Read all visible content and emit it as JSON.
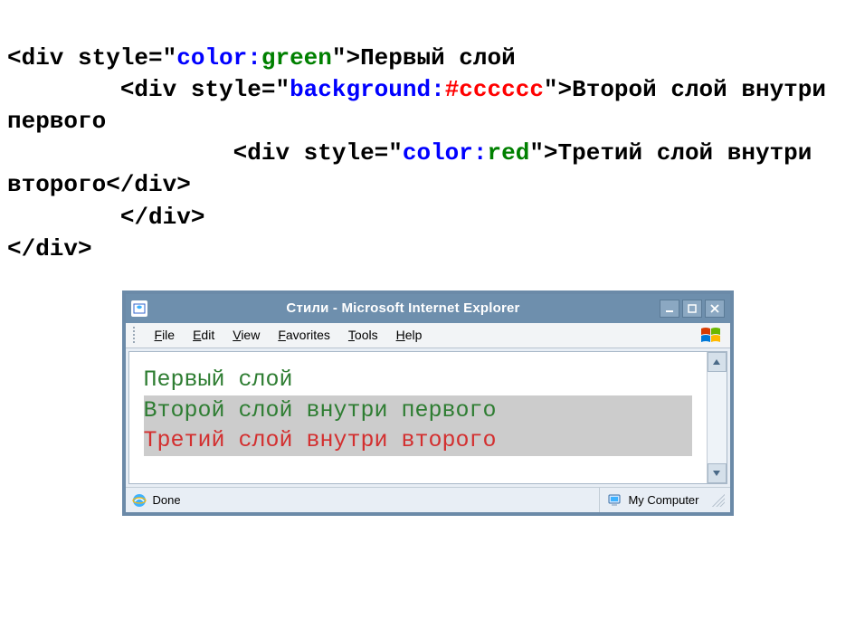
{
  "code": {
    "l1_open": "<div style=\"",
    "l1_prop": "color:",
    "l1_val": "green",
    "l1_close_and_text": "\">Первый слой",
    "l2_indent": "        ",
    "l2_open": "<div style=\"",
    "l2_prop": "background:",
    "l2_val": "#cccccc",
    "l2_close_and_text": "\">Второй слой внутри первого",
    "l3_indent": "                ",
    "l3_open": "<div style=\"",
    "l3_prop": "color:",
    "l3_val": "red",
    "l3_close_and_text": "\">Третий слой внутри второго</div>",
    "l4": "        </div>",
    "l5": "</div>"
  },
  "browser": {
    "title": "Стили - Microsoft Internet Explorer",
    "menu": {
      "file_u": "F",
      "file": "ile",
      "edit_u": "E",
      "edit": "dit",
      "view_u": "V",
      "view": "iew",
      "fav_u": "F",
      "fav": "avorites",
      "tools_u": "T",
      "tools": "ools",
      "help_u": "H",
      "help": "elp"
    },
    "page": {
      "line1": "Первый слой",
      "line2": "Второй слой внутри первого",
      "line3": "Третий слой внутри второго"
    },
    "status": {
      "done": "Done",
      "zone": "My Computer"
    }
  }
}
